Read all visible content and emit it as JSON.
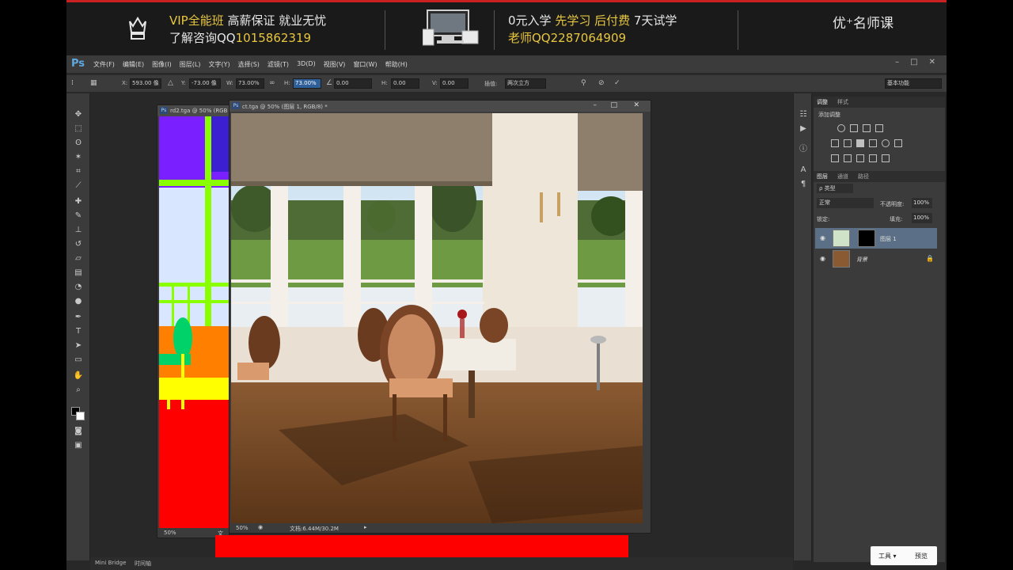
{
  "banner": {
    "line1_a": "VIP全能班",
    "line1_b": "高薪保证  就业无忧",
    "line2_a": "了解咨询QQ",
    "line2_b": "1015862319",
    "line3_a": "0元入学",
    "line3_b": "先学习  后付费",
    "line3_c": "7天试学",
    "line4_a": "老师QQ",
    "line4_b": "2287064909",
    "brand": "优⁺名师课"
  },
  "app": {
    "logo": "Ps",
    "menu": [
      "文件(F)",
      "编辑(E)",
      "图像(I)",
      "图层(L)",
      "文字(Y)",
      "选择(S)",
      "滤镜(T)",
      "3D(D)",
      "视图(V)",
      "窗口(W)",
      "帮助(H)"
    ],
    "window_controls": [
      "–",
      "□",
      "✕"
    ]
  },
  "options": {
    "x_label": "X:",
    "x_value": "593.00 像",
    "y_label": "Y:",
    "y_value": "-73.00 像",
    "w_label": "W:",
    "w_value": "73.00%",
    "h_label": "H:",
    "h_value": "73.00%",
    "angle_value": "0.00",
    "hskew_label": "H:",
    "hskew_value": "0.00",
    "vskew_label": "V:",
    "vskew_value": "0.00",
    "interp_label": "插值:",
    "interp_value": "两次立方",
    "workspace": "基本功能"
  },
  "doc1": {
    "title": "rd2.tga @ 50% (RGB",
    "zoom": "50%",
    "status": "文"
  },
  "doc2": {
    "title": "ct.tga @ 50% (图层 1, RGB/8) *",
    "zoom": "50%",
    "status": "文档:6.44M/30.2M"
  },
  "panels": {
    "tab_adjust": "调整",
    "tab_style": "样式",
    "add_adjust": "添加调整",
    "tab_layers": "图层",
    "tab_channels": "通道",
    "tab_paths": "路径",
    "filter_kind": "ρ 类型",
    "blend_mode": "正常",
    "opacity_label": "不透明度:",
    "opacity_value": "100%",
    "lock_label": "锁定:",
    "fill_label": "填充:",
    "fill_value": "100%",
    "layers": [
      {
        "name": "图层 1"
      },
      {
        "name": "背景"
      }
    ]
  },
  "bottom": {
    "minibridge": "Mini Bridge",
    "timeline": "时间轴"
  },
  "floating": {
    "tools": "工具 ▾",
    "preview": "预览"
  }
}
